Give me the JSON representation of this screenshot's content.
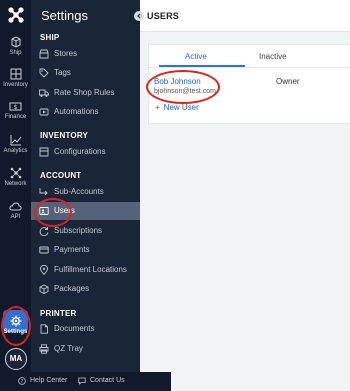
{
  "rail": {
    "items": [
      {
        "label": "Ship",
        "icon": "box-icon"
      },
      {
        "label": "Inventory",
        "icon": "grid-icon"
      },
      {
        "label": "Finance",
        "icon": "dollar-icon"
      },
      {
        "label": "Analytics",
        "icon": "chart-icon"
      },
      {
        "label": "Network",
        "icon": "network-icon"
      },
      {
        "label": "API",
        "icon": "cloud-icon"
      },
      {
        "label": "Settings",
        "icon": "gear-icon"
      }
    ],
    "avatar": "MA"
  },
  "menu": {
    "title": "Settings",
    "sections": {
      "ship": "SHIP",
      "inventory": "INVENTORY",
      "account": "ACCOUNT",
      "printer": "PRINTER"
    },
    "items": {
      "stores": "Stores",
      "tags": "Tags",
      "rate_shop_rules": "Rate Shop Rules",
      "automations": "Automations",
      "configurations": "Configurations",
      "sub_accounts": "Sub-Accounts",
      "users": "Users",
      "subscriptions": "Subscriptions",
      "payments": "Payments",
      "fulfillment_locations": "Fulfillment Locations",
      "packages": "Packages",
      "documents": "Documents",
      "qz_tray": "QZ Tray"
    },
    "footer": {
      "help": "Help Center",
      "contact": "Contact Us"
    }
  },
  "main": {
    "title": "USERS",
    "tabs": [
      "Active",
      "Inactive"
    ],
    "active_tab": "Active",
    "users": [
      {
        "name": "Bob Johnson",
        "email": "bjohnson@test.com",
        "role": "Owner"
      }
    ],
    "new_user_label": "New User"
  },
  "colors": {
    "rail_bg": "#111a2b",
    "menu_bg": "#1a2537",
    "accent": "#2d73d8",
    "active_item_bg": "#56627a",
    "annotation": "#d9241c"
  }
}
